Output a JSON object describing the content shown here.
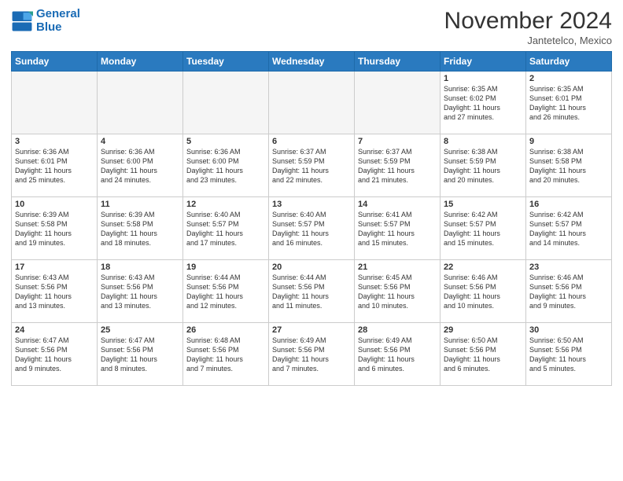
{
  "logo": {
    "line1": "General",
    "line2": "Blue"
  },
  "title": "November 2024",
  "location": "Jantetelco, Mexico",
  "days_of_week": [
    "Sunday",
    "Monday",
    "Tuesday",
    "Wednesday",
    "Thursday",
    "Friday",
    "Saturday"
  ],
  "weeks": [
    [
      {
        "day": "",
        "info": ""
      },
      {
        "day": "",
        "info": ""
      },
      {
        "day": "",
        "info": ""
      },
      {
        "day": "",
        "info": ""
      },
      {
        "day": "",
        "info": ""
      },
      {
        "day": "1",
        "info": "Sunrise: 6:35 AM\nSunset: 6:02 PM\nDaylight: 11 hours\nand 27 minutes."
      },
      {
        "day": "2",
        "info": "Sunrise: 6:35 AM\nSunset: 6:01 PM\nDaylight: 11 hours\nand 26 minutes."
      }
    ],
    [
      {
        "day": "3",
        "info": "Sunrise: 6:36 AM\nSunset: 6:01 PM\nDaylight: 11 hours\nand 25 minutes."
      },
      {
        "day": "4",
        "info": "Sunrise: 6:36 AM\nSunset: 6:00 PM\nDaylight: 11 hours\nand 24 minutes."
      },
      {
        "day": "5",
        "info": "Sunrise: 6:36 AM\nSunset: 6:00 PM\nDaylight: 11 hours\nand 23 minutes."
      },
      {
        "day": "6",
        "info": "Sunrise: 6:37 AM\nSunset: 5:59 PM\nDaylight: 11 hours\nand 22 minutes."
      },
      {
        "day": "7",
        "info": "Sunrise: 6:37 AM\nSunset: 5:59 PM\nDaylight: 11 hours\nand 21 minutes."
      },
      {
        "day": "8",
        "info": "Sunrise: 6:38 AM\nSunset: 5:59 PM\nDaylight: 11 hours\nand 20 minutes."
      },
      {
        "day": "9",
        "info": "Sunrise: 6:38 AM\nSunset: 5:58 PM\nDaylight: 11 hours\nand 20 minutes."
      }
    ],
    [
      {
        "day": "10",
        "info": "Sunrise: 6:39 AM\nSunset: 5:58 PM\nDaylight: 11 hours\nand 19 minutes."
      },
      {
        "day": "11",
        "info": "Sunrise: 6:39 AM\nSunset: 5:58 PM\nDaylight: 11 hours\nand 18 minutes."
      },
      {
        "day": "12",
        "info": "Sunrise: 6:40 AM\nSunset: 5:57 PM\nDaylight: 11 hours\nand 17 minutes."
      },
      {
        "day": "13",
        "info": "Sunrise: 6:40 AM\nSunset: 5:57 PM\nDaylight: 11 hours\nand 16 minutes."
      },
      {
        "day": "14",
        "info": "Sunrise: 6:41 AM\nSunset: 5:57 PM\nDaylight: 11 hours\nand 15 minutes."
      },
      {
        "day": "15",
        "info": "Sunrise: 6:42 AM\nSunset: 5:57 PM\nDaylight: 11 hours\nand 15 minutes."
      },
      {
        "day": "16",
        "info": "Sunrise: 6:42 AM\nSunset: 5:57 PM\nDaylight: 11 hours\nand 14 minutes."
      }
    ],
    [
      {
        "day": "17",
        "info": "Sunrise: 6:43 AM\nSunset: 5:56 PM\nDaylight: 11 hours\nand 13 minutes."
      },
      {
        "day": "18",
        "info": "Sunrise: 6:43 AM\nSunset: 5:56 PM\nDaylight: 11 hours\nand 13 minutes."
      },
      {
        "day": "19",
        "info": "Sunrise: 6:44 AM\nSunset: 5:56 PM\nDaylight: 11 hours\nand 12 minutes."
      },
      {
        "day": "20",
        "info": "Sunrise: 6:44 AM\nSunset: 5:56 PM\nDaylight: 11 hours\nand 11 minutes."
      },
      {
        "day": "21",
        "info": "Sunrise: 6:45 AM\nSunset: 5:56 PM\nDaylight: 11 hours\nand 10 minutes."
      },
      {
        "day": "22",
        "info": "Sunrise: 6:46 AM\nSunset: 5:56 PM\nDaylight: 11 hours\nand 10 minutes."
      },
      {
        "day": "23",
        "info": "Sunrise: 6:46 AM\nSunset: 5:56 PM\nDaylight: 11 hours\nand 9 minutes."
      }
    ],
    [
      {
        "day": "24",
        "info": "Sunrise: 6:47 AM\nSunset: 5:56 PM\nDaylight: 11 hours\nand 9 minutes."
      },
      {
        "day": "25",
        "info": "Sunrise: 6:47 AM\nSunset: 5:56 PM\nDaylight: 11 hours\nand 8 minutes."
      },
      {
        "day": "26",
        "info": "Sunrise: 6:48 AM\nSunset: 5:56 PM\nDaylight: 11 hours\nand 7 minutes."
      },
      {
        "day": "27",
        "info": "Sunrise: 6:49 AM\nSunset: 5:56 PM\nDaylight: 11 hours\nand 7 minutes."
      },
      {
        "day": "28",
        "info": "Sunrise: 6:49 AM\nSunset: 5:56 PM\nDaylight: 11 hours\nand 6 minutes."
      },
      {
        "day": "29",
        "info": "Sunrise: 6:50 AM\nSunset: 5:56 PM\nDaylight: 11 hours\nand 6 minutes."
      },
      {
        "day": "30",
        "info": "Sunrise: 6:50 AM\nSunset: 5:56 PM\nDaylight: 11 hours\nand 5 minutes."
      }
    ]
  ]
}
